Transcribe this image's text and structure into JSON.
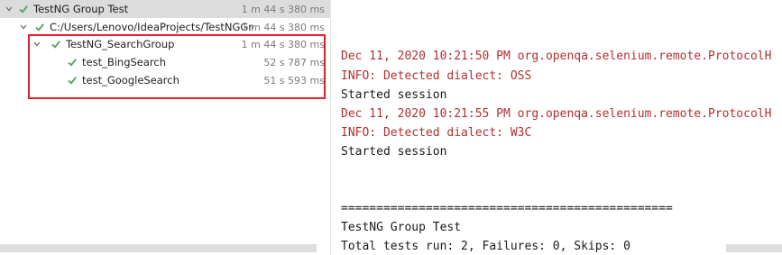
{
  "tree": {
    "rows": [
      {
        "label": "TestNG Group Test",
        "time": "1 m 44 s 380 ms"
      },
      {
        "label": "C:/Users/Lenovo/IdeaProjects/TestNGGrou",
        "time": "1 m 44 s 380 ms"
      },
      {
        "label": "TestNG_SearchGroup",
        "time": "1 m 44 s 380 ms"
      },
      {
        "label": "test_BingSearch",
        "time": "52 s 787 ms"
      },
      {
        "label": "test_GoogleSearch",
        "time": "51 s 593 ms"
      }
    ]
  },
  "console": {
    "lines": [
      "Dec 11, 2020 10:21:50 PM org.openqa.selenium.remote.ProtocolH",
      "INFO: Detected dialect: OSS",
      "Started session",
      "Dec 11, 2020 10:21:55 PM org.openqa.selenium.remote.ProtocolH",
      "INFO: Detected dialect: W3C",
      "Started session",
      "",
      "",
      "===============================================",
      "TestNG Group Test",
      "Total tests run: 2, Failures: 0, Skips: 0"
    ]
  },
  "colors": {
    "pass_check": "#59a869",
    "error_text": "#b32f2f",
    "highlight_border": "#e0202a",
    "selected_row": "#dcdcdc"
  },
  "icons": [
    "chevron-down-icon",
    "check-icon"
  ]
}
